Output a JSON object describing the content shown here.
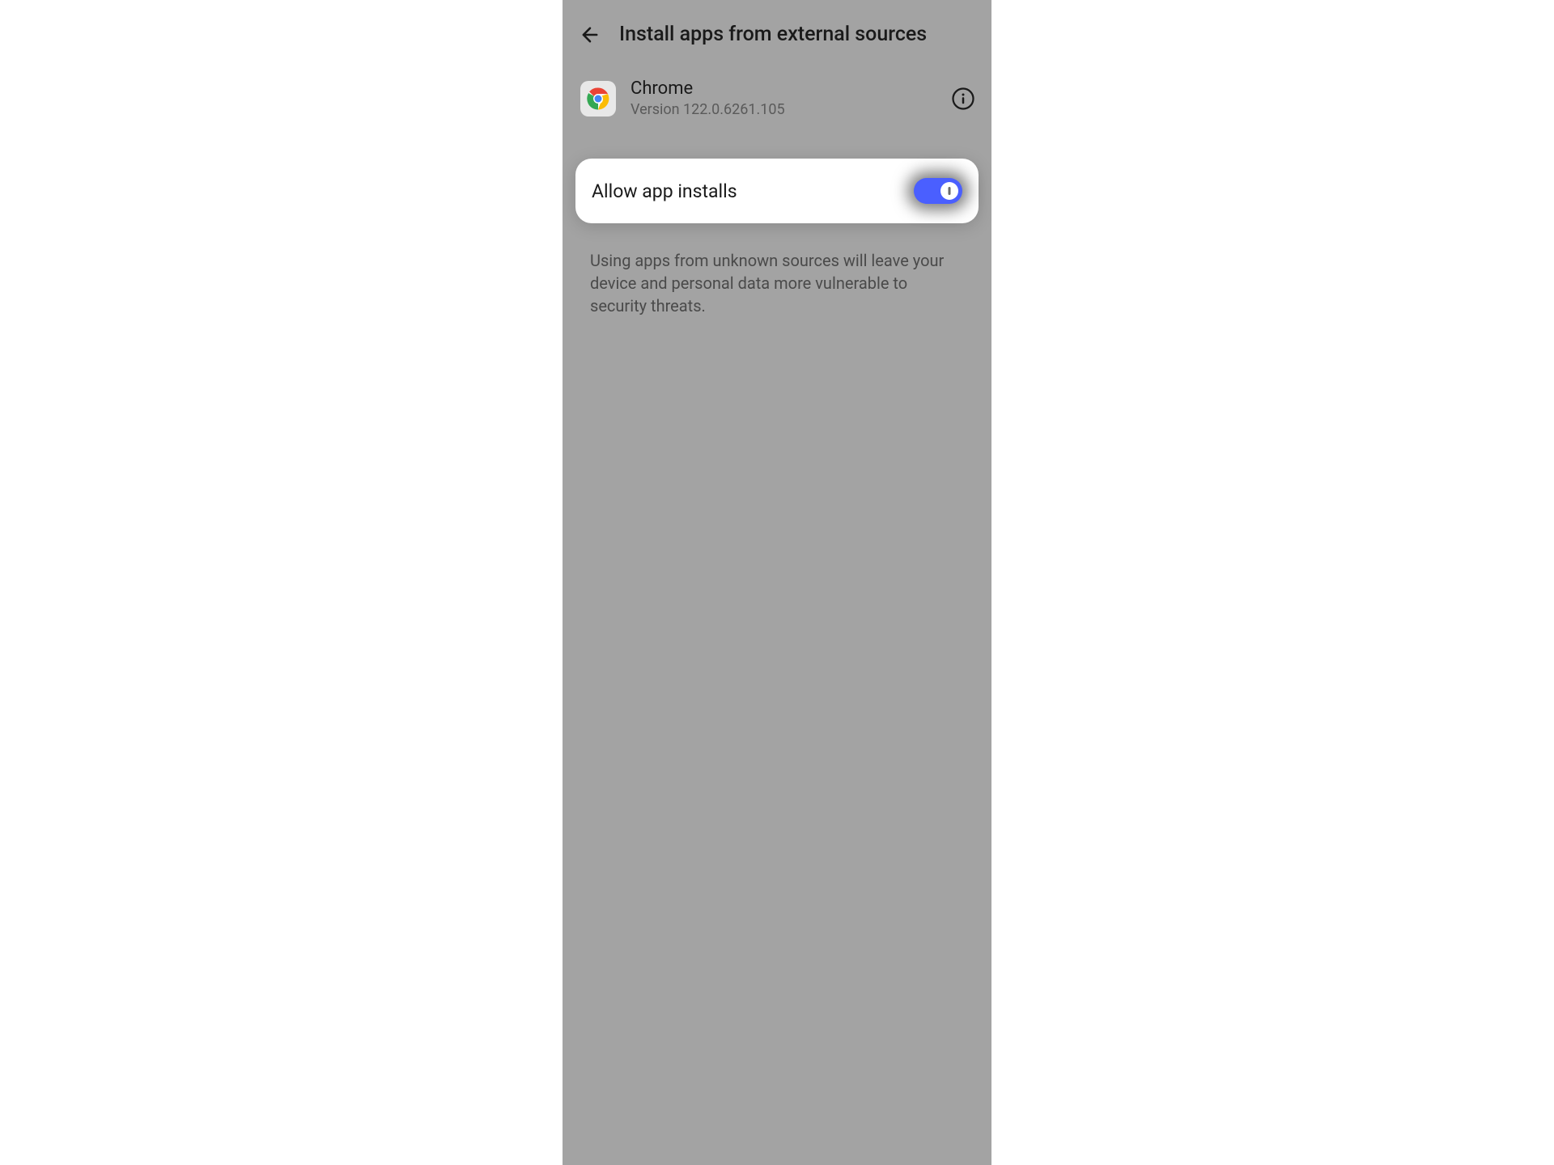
{
  "header": {
    "title": "Install apps from external sources"
  },
  "app": {
    "name": "Chrome",
    "version": "Version 122.0.6261.105"
  },
  "toggle": {
    "label": "Allow app installs",
    "state": "on",
    "accent_color": "#4a5fff"
  },
  "warning": "Using apps from unknown sources will leave your device and personal data more vulnerable to security threats."
}
